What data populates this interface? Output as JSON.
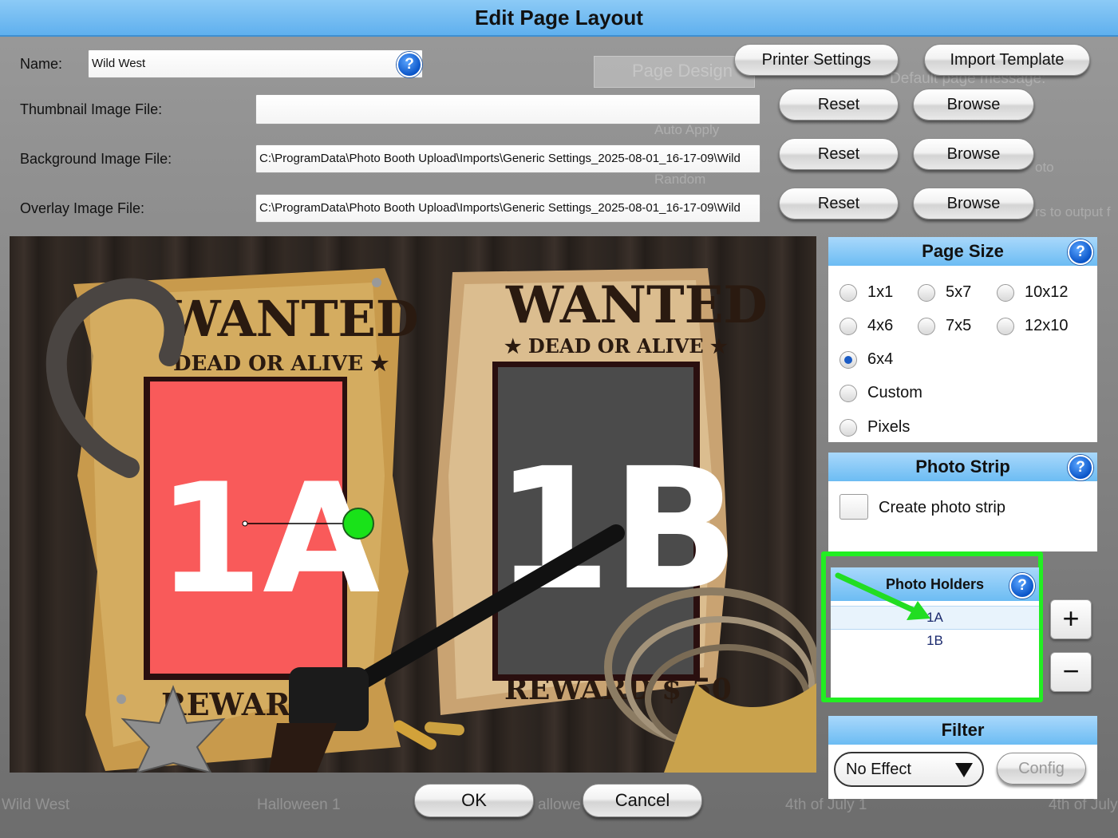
{
  "window": {
    "title": "Edit Page Layout"
  },
  "form": {
    "name_label": "Name:",
    "name_value": "Wild West",
    "thumb_label": "Thumbnail Image File:",
    "thumb_value": "",
    "background_label": "Background Image File:",
    "background_value": "C:\\ProgramData\\Photo Booth Upload\\Imports\\Generic Settings_2025-08-01_16-17-09\\Wild",
    "overlay_label": "Overlay Image File:",
    "overlay_value": "C:\\ProgramData\\Photo Booth Upload\\Imports\\Generic Settings_2025-08-01_16-17-09\\Wild"
  },
  "toolbar": {
    "printer_settings": "Printer Settings",
    "import_template": "Import Template",
    "reset": "Reset",
    "browse": "Browse"
  },
  "canvas": {
    "holder_1a": "1A",
    "holder_1b": "1B",
    "poster_wanted": "WANTED",
    "poster_dead_or_alive": "DEAD OR ALIVE",
    "poster_reward_left": "REWARD $",
    "poster_reward_right": "REWARD $ 50",
    "holder_1a_color": "#f95a5a",
    "holder_1b_color": "#4b4b4b"
  },
  "page_size": {
    "title": "Page Size",
    "options": [
      "1x1",
      "5x7",
      "10x12",
      "4x6",
      "7x5",
      "12x10",
      "6x4",
      "Custom",
      "Pixels"
    ],
    "selected": "6x4"
  },
  "photo_strip": {
    "title": "Photo Strip",
    "checkbox_label": "Create photo strip",
    "checked": false
  },
  "photo_holders": {
    "title": "Photo Holders",
    "items": [
      "1A",
      "1B"
    ],
    "selected": "1A",
    "add_label": "+",
    "remove_label": "−",
    "highlight_color": "#22ee22"
  },
  "filter": {
    "title": "Filter",
    "selected": "No Effect",
    "config_label": "Config"
  },
  "dialog_buttons": {
    "ok": "OK",
    "cancel": "Cancel"
  },
  "background_ghost": {
    "page_design": "Page Design",
    "default_message": "Default page message:",
    "auto_apply": "Auto Apply",
    "random": "Random",
    "photo": "oto",
    "output": "rs to output f",
    "templates": [
      "Wild West",
      "Halloween 1",
      "allowe",
      "4th of July 1",
      "4th of July"
    ]
  },
  "colors": {
    "accent": "#6cbcf3",
    "title_bar": "#5fb0ee"
  }
}
